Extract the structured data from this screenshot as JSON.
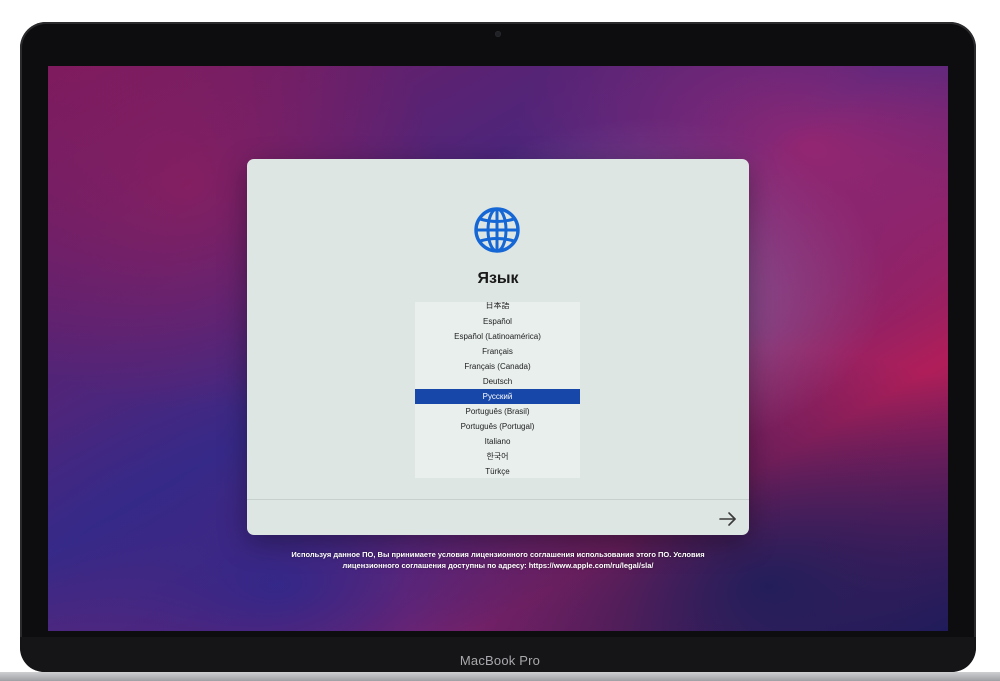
{
  "device": {
    "brand_label": "MacBook Pro"
  },
  "setup": {
    "title": "Язык",
    "icon": "globe-icon",
    "accent_color": "#1747a8",
    "selected_language": "Русский",
    "languages": [
      "日本語",
      "Español",
      "Español (Latinoamérica)",
      "Français",
      "Français (Canada)",
      "Deutsch",
      "Русский",
      "Português (Brasil)",
      "Português (Portugal)",
      "Italiano",
      "한국어",
      "Türkçe"
    ],
    "continue_icon": "arrow-right-icon"
  },
  "license": {
    "line1": "Используя данное ПО, Вы принимаете условия лицензионного соглашения использования этого ПО. Условия",
    "line2": "лицензионного соглашения доступны по адресу: https://www.apple.com/ru/legal/sla/"
  }
}
